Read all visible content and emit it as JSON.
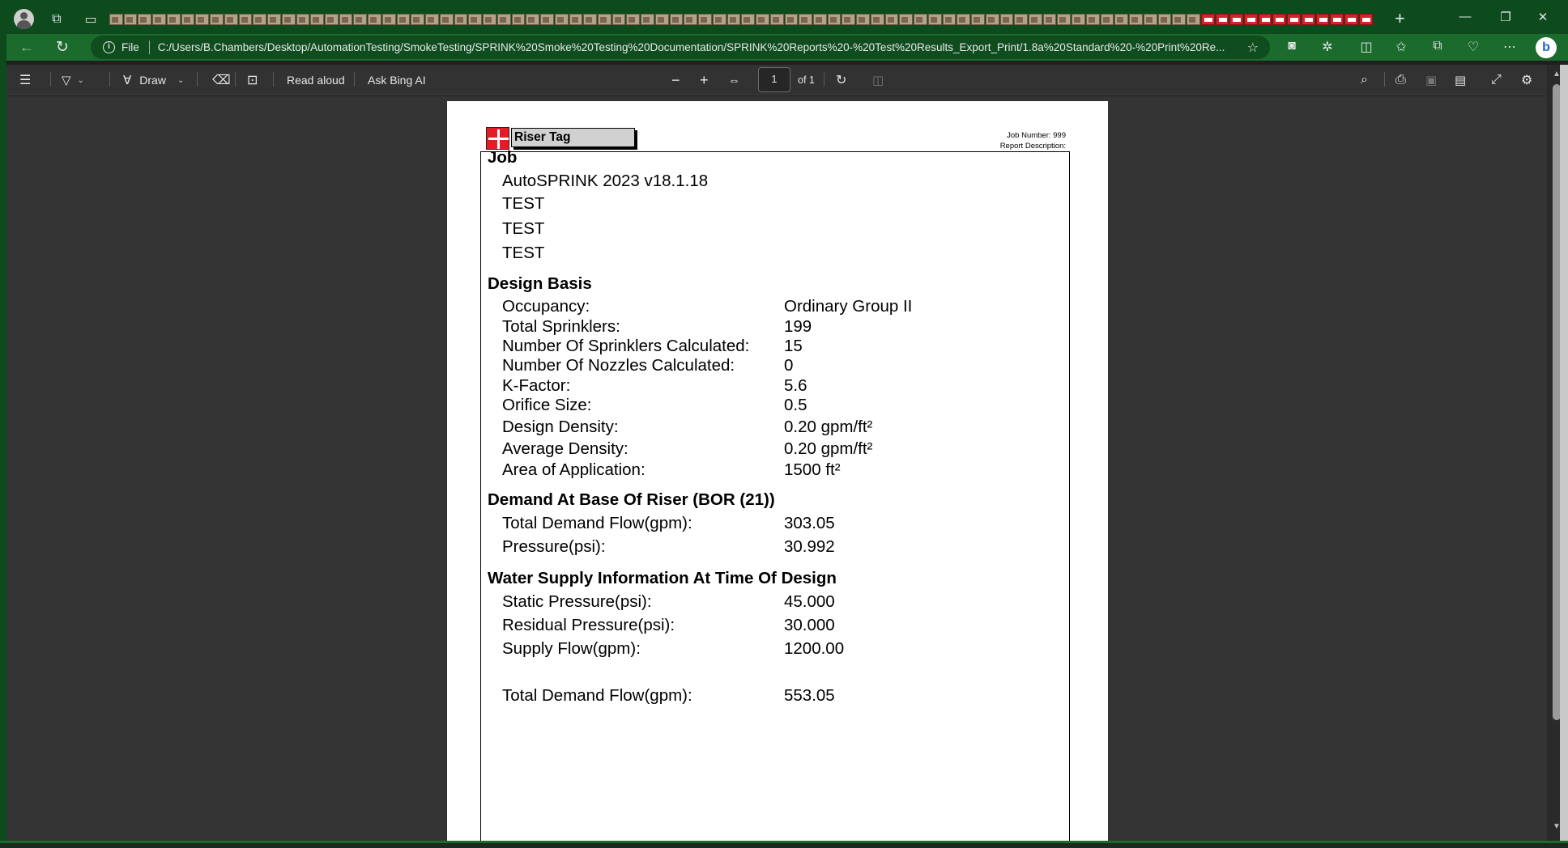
{
  "browser": {
    "file_label": "File",
    "url": "C:/Users/B.Chambers/Desktop/AutomationTesting/SmokeTesting/SPRINK%20Smoke%20Testing%20Documentation/SPRINK%20Reports%20-%20Test%20Results_Export_Print/1.8a%20Standard%20-%20Print%20Re..."
  },
  "pdf_toolbar": {
    "draw_label": "Draw",
    "read_aloud_label": "Read aloud",
    "ask_bing_label": "Ask Bing AI",
    "page_number": "1",
    "page_total": "of 1"
  },
  "report": {
    "riser_tag": "Riser Tag",
    "job_number": "Job Number: 999",
    "report_description": "Report Description:",
    "job": {
      "title": "Job",
      "lines": [
        "AutoSPRINK 2023 v18.1.18",
        "TEST",
        "TEST",
        "TEST"
      ]
    },
    "design_basis": {
      "title": "Design Basis",
      "rows": [
        {
          "label": "Occupancy:",
          "value": "Ordinary Group II"
        },
        {
          "label": "Total Sprinklers:",
          "value": "199"
        },
        {
          "label": "Number Of Sprinklers Calculated:",
          "value": "15"
        },
        {
          "label": "Number Of Nozzles Calculated:",
          "value": "0"
        },
        {
          "label": "K-Factor:",
          "value": "5.6"
        },
        {
          "label": "Orifice Size:",
          "value": "0.5"
        },
        {
          "label": "Design Density:",
          "value": "0.20 gpm/ft²"
        },
        {
          "label": "Average Density:",
          "value": "0.20 gpm/ft²"
        },
        {
          "label": "Area of Application:",
          "value": "1500 ft²"
        }
      ]
    },
    "demand": {
      "title": "Demand At Base Of Riser (BOR (21))",
      "rows": [
        {
          "label": "Total Demand Flow(gpm):",
          "value": "303.05"
        },
        {
          "label": "Pressure(psi):",
          "value": "30.992"
        }
      ]
    },
    "water_supply": {
      "title": "Water Supply Information At Time Of Design",
      "rows": [
        {
          "label": "Static Pressure(psi):",
          "value": "45.000"
        },
        {
          "label": "Residual Pressure(psi):",
          "value": "30.000"
        },
        {
          "label": "Supply Flow(gpm):",
          "value": "1200.00"
        },
        {
          "label": "Total Demand Flow(gpm):",
          "value": "553.05"
        }
      ]
    }
  }
}
